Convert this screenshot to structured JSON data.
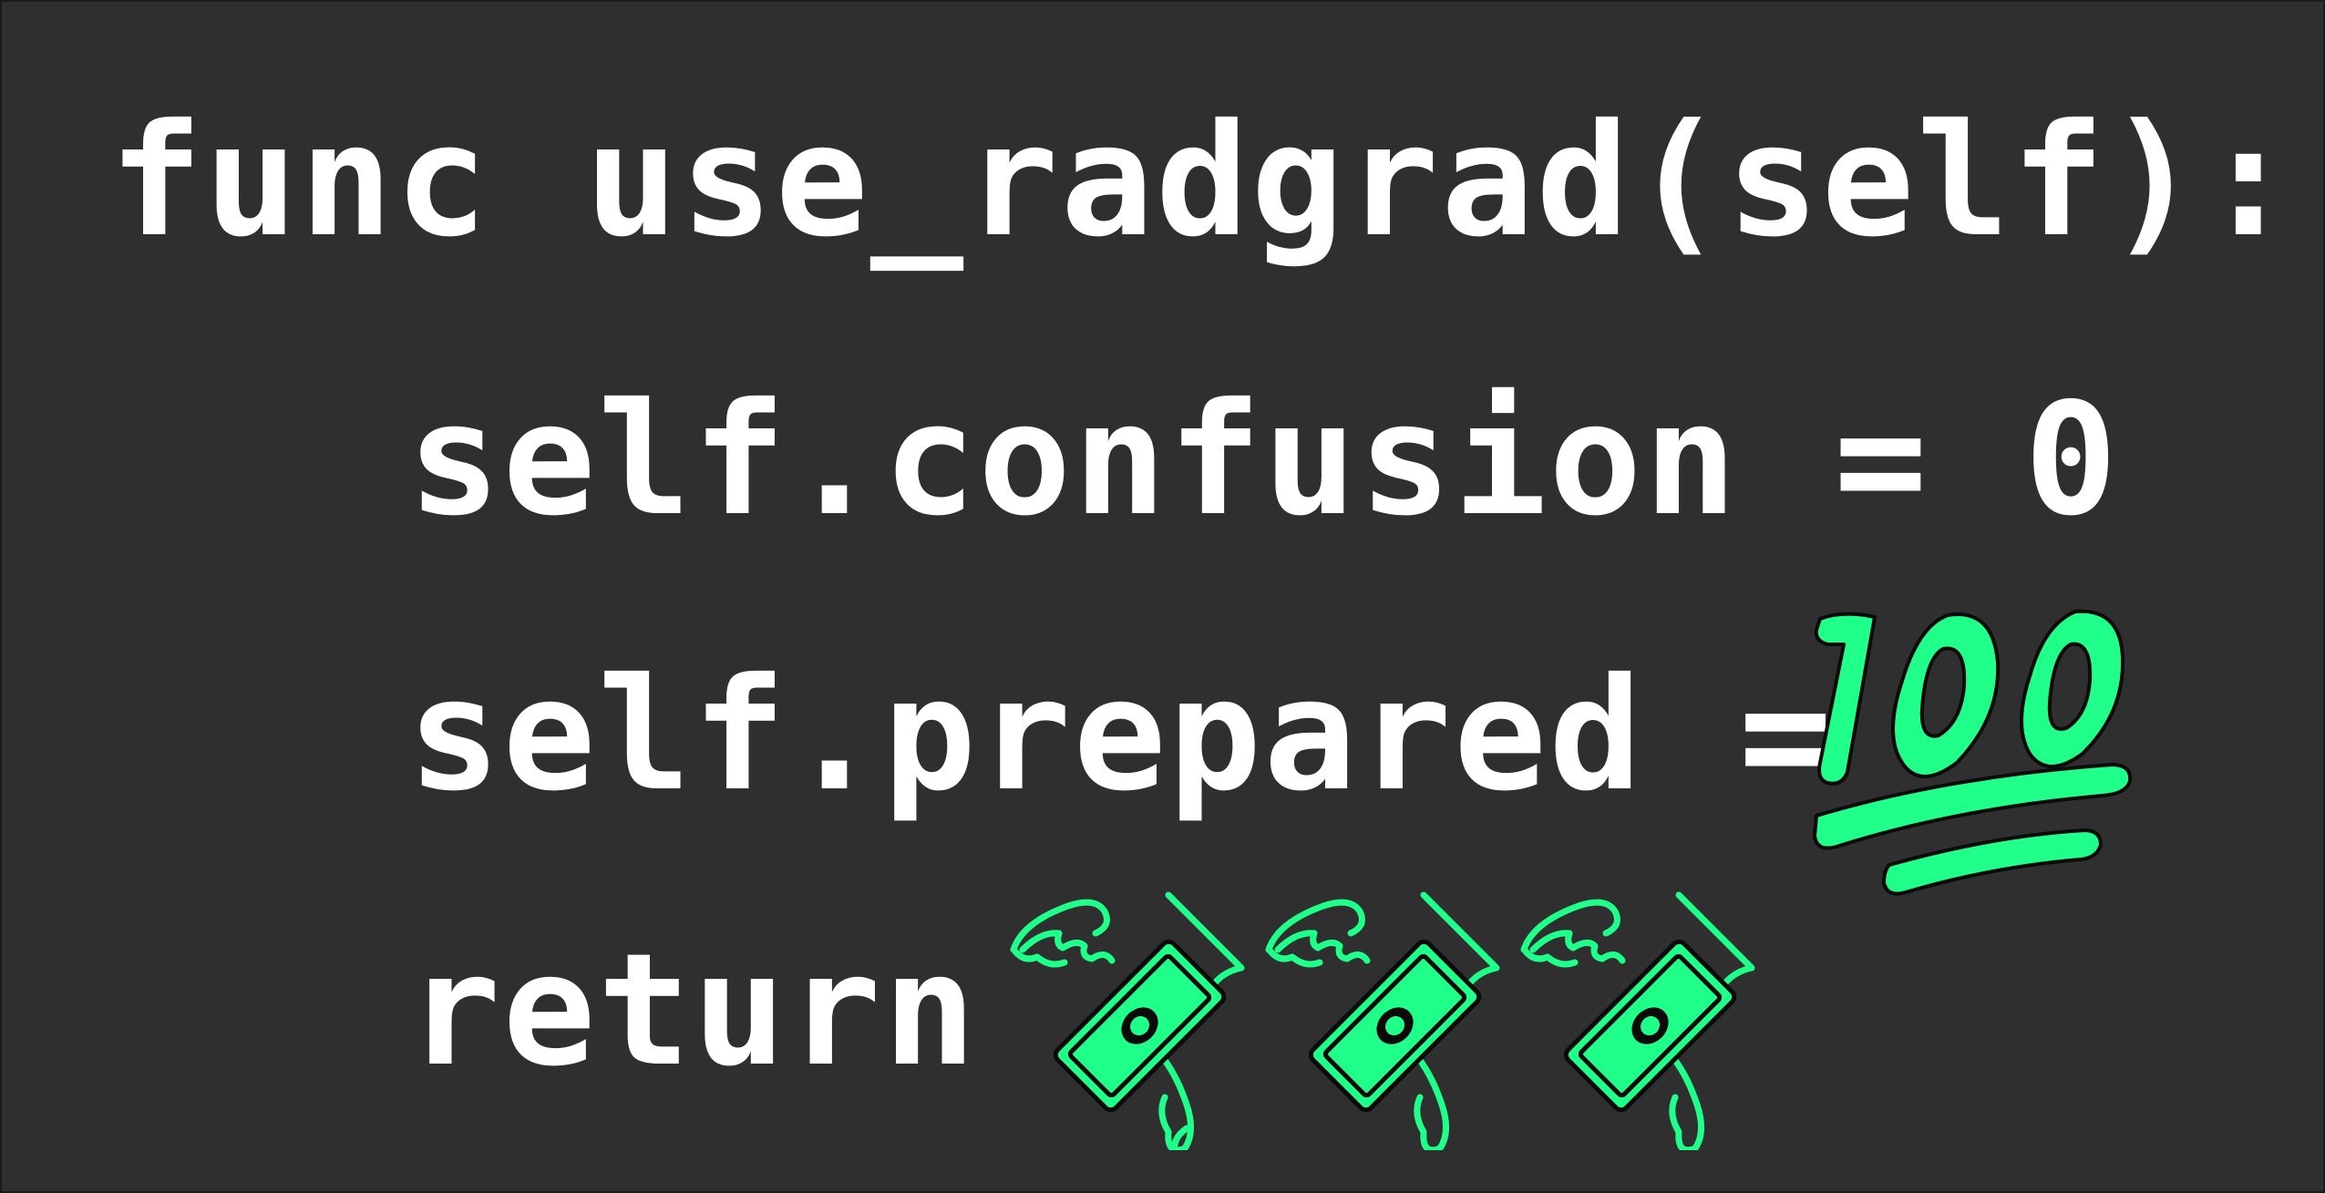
{
  "code": {
    "line1": "func use_radgrad(self):",
    "line2": "self.confusion = 0",
    "line3": "self.prepared =",
    "line4": "return"
  },
  "icons": {
    "hundred": "hundred-points-emoji-icon",
    "money": "money-with-wings-emoji-icon"
  },
  "colors": {
    "background": "#2f2f2f",
    "text": "#ffffff",
    "accent": "#1fff8a"
  }
}
